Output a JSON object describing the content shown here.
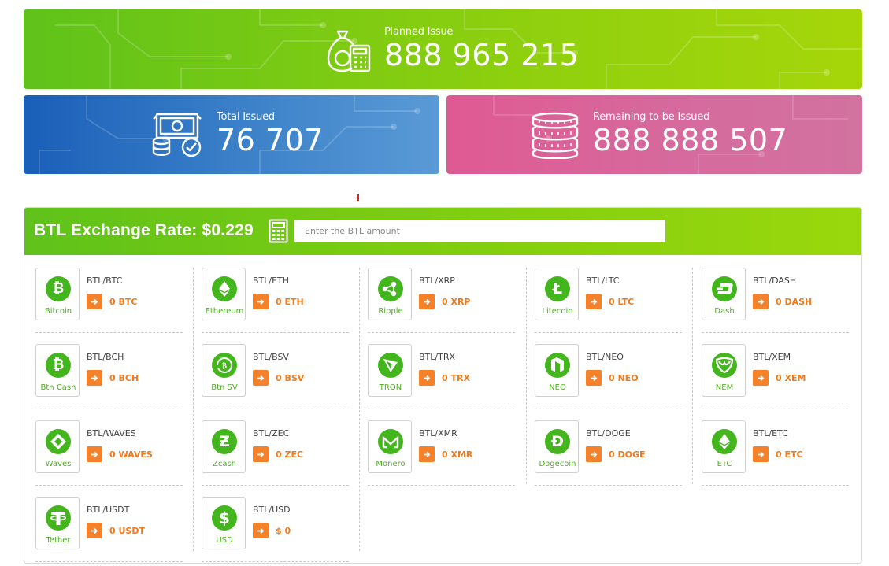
{
  "banners": {
    "planned": {
      "label": "Planned Issue",
      "value": "888 965 215"
    },
    "total": {
      "label": "Total Issued",
      "value": "76 707"
    },
    "remaining": {
      "label": "Remaining to be Issued",
      "value": "888 888 507"
    }
  },
  "exchange": {
    "title": "BTL Exchange Rate: $0.229",
    "input_placeholder": "Enter the BTL amount",
    "input_value": ""
  },
  "coins": [
    {
      "name": "Bitcoin",
      "pair": "BTL/BTC",
      "value": "0 BTC",
      "icon": "bitcoin-icon"
    },
    {
      "name": "Ethereum",
      "pair": "BTL/ETH",
      "value": "0 ETH",
      "icon": "ethereum-icon"
    },
    {
      "name": "Ripple",
      "pair": "BTL/XRP",
      "value": "0 XRP",
      "icon": "ripple-icon"
    },
    {
      "name": "Litecoin",
      "pair": "BTL/LTC",
      "value": "0 LTC",
      "icon": "litecoin-icon"
    },
    {
      "name": "Dash",
      "pair": "BTL/DASH",
      "value": "0 DASH",
      "icon": "dash-icon"
    },
    {
      "name": "Btn Cash",
      "pair": "BTL/BCH",
      "value": "0 BCH",
      "icon": "bitcoin-cash-icon"
    },
    {
      "name": "Btn SV",
      "pair": "BTL/BSV",
      "value": "0 BSV",
      "icon": "bitcoin-sv-icon"
    },
    {
      "name": "TRON",
      "pair": "BTL/TRX",
      "value": "0 TRX",
      "icon": "tron-icon"
    },
    {
      "name": "NEO",
      "pair": "BTL/NEO",
      "value": "0 NEO",
      "icon": "neo-icon"
    },
    {
      "name": "NEM",
      "pair": "BTL/XEM",
      "value": "0 XEM",
      "icon": "nem-icon"
    },
    {
      "name": "Waves",
      "pair": "BTL/WAVES",
      "value": "0 WAVES",
      "icon": "waves-icon"
    },
    {
      "name": "Zcash",
      "pair": "BTL/ZEC",
      "value": "0 ZEC",
      "icon": "zcash-icon"
    },
    {
      "name": "Monero",
      "pair": "BTL/XMR",
      "value": "0 XMR",
      "icon": "monero-icon"
    },
    {
      "name": "Dogecoin",
      "pair": "BTL/DOGE",
      "value": "0 DOGE",
      "icon": "dogecoin-icon"
    },
    {
      "name": "ETC",
      "pair": "BTL/ETC",
      "value": "0 ETC",
      "icon": "ethereum-classic-icon"
    },
    {
      "name": "Tether",
      "pair": "BTL/USDT",
      "value": "0 USDT",
      "icon": "tether-icon"
    },
    {
      "name": "USD",
      "pair": "BTL/USD",
      "value": "$ 0",
      "icon": "dollar-icon"
    }
  ],
  "colors": {
    "green": "#43b51d",
    "orange": "#f5822a",
    "blue": "#1a5fb8",
    "pink": "#df5a92"
  }
}
